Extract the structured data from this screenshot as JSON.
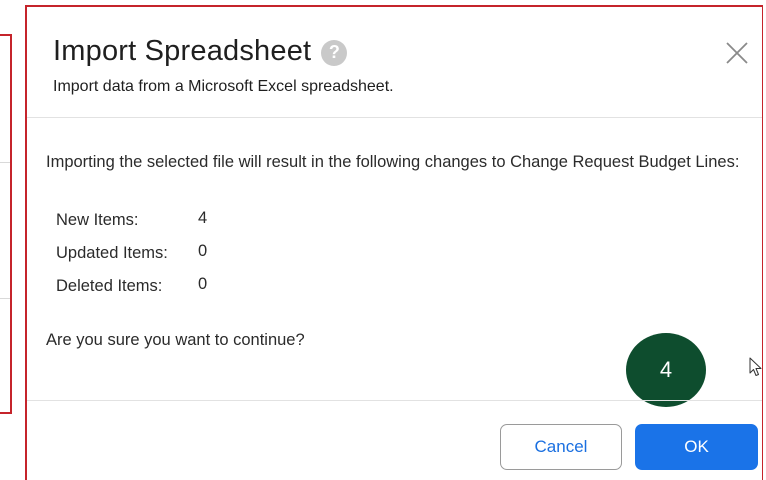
{
  "dialog": {
    "title": "Import Spreadsheet",
    "help_icon": "question-mark-icon",
    "subtitle": "Import data from a Microsoft Excel spreadsheet.",
    "close_icon": "close-icon",
    "message": "Importing the selected file will result in the following changes to Change Request Budget Lines:",
    "stats": [
      {
        "label": "New Items:",
        "value": "4"
      },
      {
        "label": "Updated Items:",
        "value": "0"
      },
      {
        "label": "Deleted Items:",
        "value": "0"
      }
    ],
    "confirm_prompt": "Are you sure you want to continue?",
    "cancel_label": "Cancel",
    "ok_label": "OK"
  },
  "annotation": {
    "step_number": "4"
  },
  "colors": {
    "highlight_border": "#c5242b",
    "primary_button": "#1a73e8",
    "step_badge": "#0e4d2e"
  }
}
